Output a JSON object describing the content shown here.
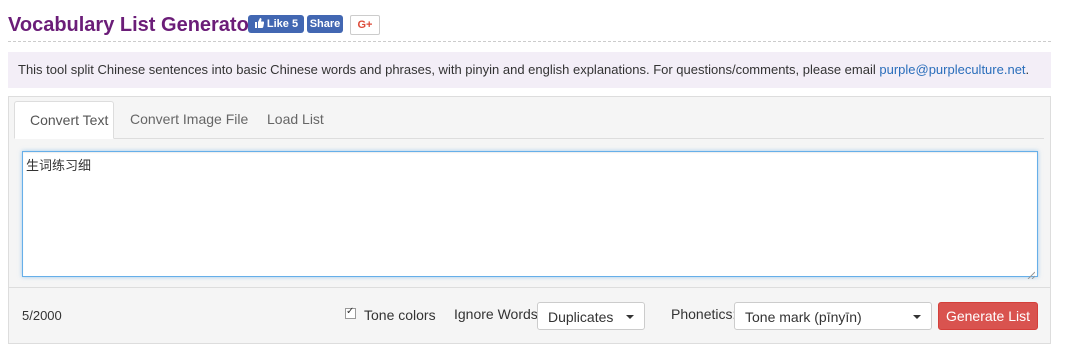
{
  "header": {
    "title": "Vocabulary List Generator",
    "fb_like_label": "Like 5",
    "fb_share_label": "Share",
    "gplus_label": "G+"
  },
  "notice": {
    "text": "This tool split Chinese sentences into basic Chinese words and phrases, with pinyin and english explanations. For questions/comments, please email ",
    "email": "purple@purpleculture.net",
    "end": "."
  },
  "tabs": [
    {
      "label": "Convert Text",
      "active": true
    },
    {
      "label": "Convert Image File",
      "active": false
    },
    {
      "label": "Load List",
      "active": false
    }
  ],
  "input": {
    "value": "生词练习细"
  },
  "footer": {
    "count": "5/2000",
    "tone_colors_label": "Tone colors",
    "tone_colors_checked": true,
    "ignore_words_label": "Ignore Words:",
    "ignore_words_value": "Duplicates",
    "phonetics_label": "Phonetics:",
    "phonetics_value": "Tone mark (pīnyīn)",
    "generate_label": "Generate List"
  },
  "colors": {
    "title": "#6b1d78",
    "notice_bg": "#f3eef7",
    "facebook": "#4267b2",
    "generate_button": "#d9534f",
    "link": "#2a6ebb"
  }
}
